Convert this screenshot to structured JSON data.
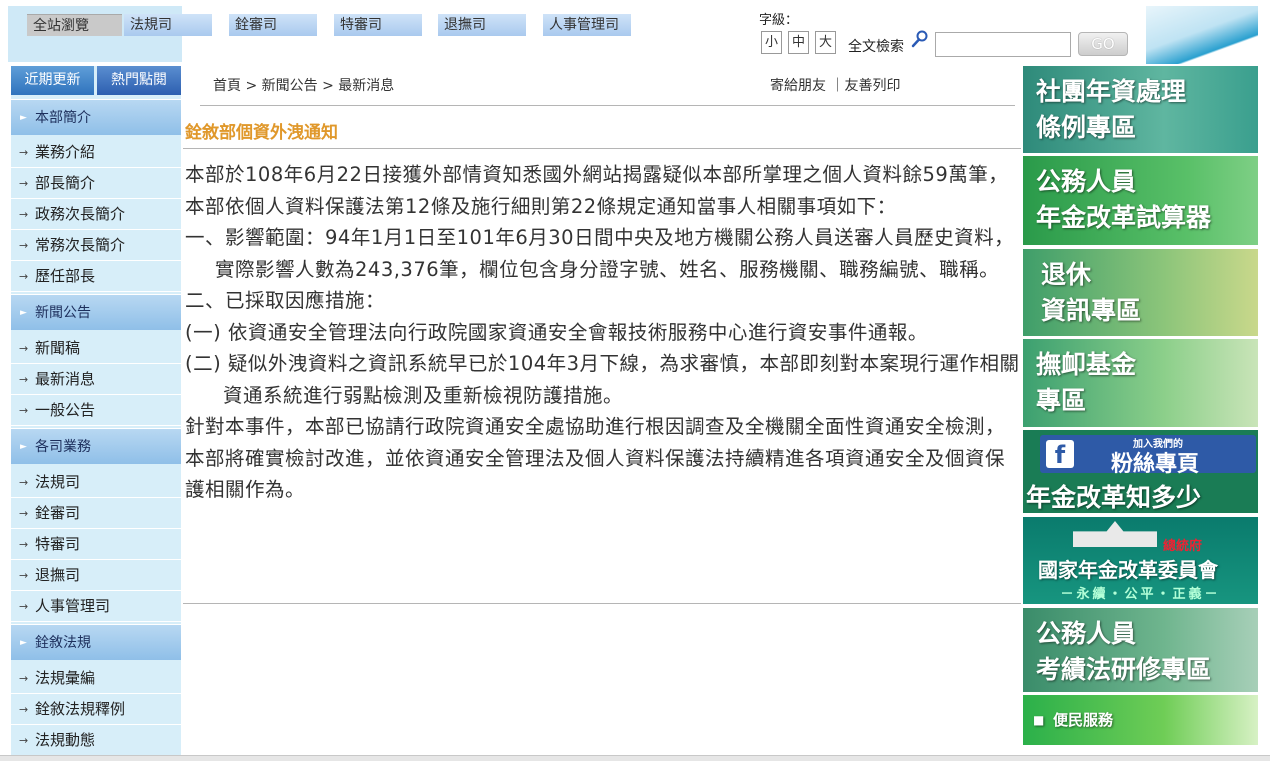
{
  "top_nav": {
    "tabs": [
      {
        "label": "全站瀏覽",
        "active": true
      },
      {
        "label": "法規司"
      },
      {
        "label": "銓審司"
      },
      {
        "label": "特審司"
      },
      {
        "label": "退撫司"
      },
      {
        "label": "人事管理司"
      }
    ]
  },
  "toolbar": {
    "font_size_label": "字級：",
    "font_sizes": [
      "小",
      "中",
      "大"
    ],
    "search_label": "全文檢索",
    "search_value": "",
    "go_label": "GO"
  },
  "sidebar": {
    "top_buttons": [
      "近期更新",
      "熱門點閱"
    ],
    "sections": [
      {
        "title": "本部簡介",
        "items": [
          "業務介紹",
          "部長簡介",
          "政務次長簡介",
          "常務次長簡介",
          "歷任部長"
        ]
      },
      {
        "title": "新聞公告",
        "items": [
          "新聞稿",
          "最新消息",
          "一般公告"
        ]
      },
      {
        "title": "各司業務",
        "items": [
          "法規司",
          "銓審司",
          "特審司",
          "退撫司",
          "人事管理司"
        ]
      },
      {
        "title": "銓敘法規",
        "items": [
          "法規彙編",
          "銓敘法規釋例",
          "法規動態"
        ]
      }
    ]
  },
  "main": {
    "breadcrumb": "首頁 > 新聞公告 > 最新消息",
    "share_links": "寄給朋友 ｜友善列印",
    "title": "銓敘部個資外洩通知",
    "paragraphs": [
      "本部於108年6月22日接獲外部情資知悉國外網站揭露疑似本部所掌理之個人資料餘59萬筆，本部依個人資料保護法第12條及施行細則第22條規定通知當事人相關事項如下：",
      "一、影響範圍：94年1月1日至101年6月30日間中央及地方機關公務人員送審人員歷史資料，實際影響人數為243,376筆，欄位包含身分證字號、姓名、服務機關、職務編號、職稱。",
      "二、已採取因應措施：",
      "(一) 依資通安全管理法向行政院國家資通安全會報技術服務中心進行資安事件通報。",
      "(二) 疑似外洩資料之資訊系統早已於104年3月下線，為求審慎，本部即刻對本案現行運作相關資通系統進行弱點檢測及重新檢視防護措施。",
      "針對本事件，本部已協請行政院資通安全處協助進行根因調查及全機關全面性資通安全檢測，本部將確實檢討改進，並依資通安全管理法及個人資料保護法持續精進各項資通安全及個資保護相關作為。"
    ]
  },
  "banners": {
    "b1": [
      "社團年資處理",
      "條例專區"
    ],
    "b2": [
      "公務人員",
      "年金改革試算器"
    ],
    "b3": [
      "退休",
      "資訊專區"
    ],
    "b4": [
      "撫卹基金",
      "專區"
    ],
    "b5": {
      "small": "加入我們的",
      "big": "粉絲專頁",
      "bottom": "年金改革知多少"
    },
    "b6": {
      "sub": "總統府",
      "main": "國家年金改革委員會",
      "motto": "－永續・公平・正義－"
    },
    "b7": [
      "公務人員",
      "考績法研修專區"
    ],
    "b8": "便民服務"
  }
}
